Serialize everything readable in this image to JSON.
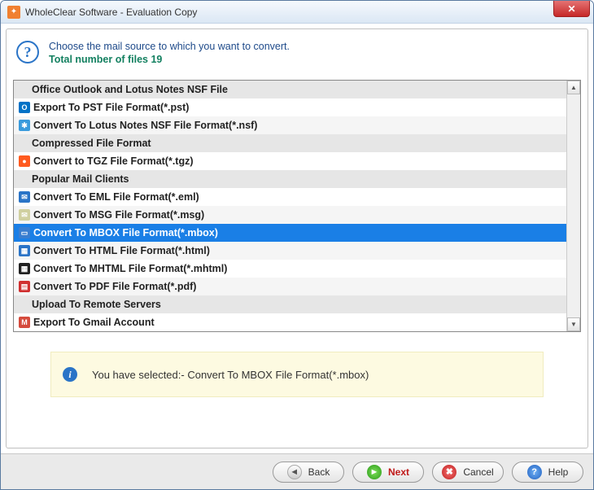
{
  "window": {
    "title": "WholeClear Software - Evaluation Copy"
  },
  "instruction": {
    "line1": "Choose the mail source to which you want to convert.",
    "line2": "Total number of files 19"
  },
  "list": [
    {
      "type": "header",
      "label": "Office Outlook and Lotus Notes NSF File"
    },
    {
      "type": "item",
      "icon": "outlook",
      "label": "Export To PST File Format(*.pst)"
    },
    {
      "type": "item",
      "icon": "lotus",
      "label": "Convert To Lotus Notes NSF File Format(*.nsf)"
    },
    {
      "type": "header",
      "label": "Compressed File Format"
    },
    {
      "type": "item",
      "icon": "tgz",
      "label": "Convert to TGZ File Format(*.tgz)"
    },
    {
      "type": "header",
      "label": "Popular Mail Clients"
    },
    {
      "type": "item",
      "icon": "eml",
      "label": "Convert To EML File Format(*.eml)"
    },
    {
      "type": "item",
      "icon": "msg",
      "label": "Convert To MSG File Format(*.msg)"
    },
    {
      "type": "item",
      "icon": "mbox",
      "label": "Convert To MBOX File Format(*.mbox)",
      "selected": true
    },
    {
      "type": "item",
      "icon": "html",
      "label": "Convert To HTML File Format(*.html)"
    },
    {
      "type": "item",
      "icon": "mhtml",
      "label": "Convert To MHTML File Format(*.mhtml)"
    },
    {
      "type": "item",
      "icon": "pdf",
      "label": "Convert To PDF File Format(*.pdf)"
    },
    {
      "type": "header",
      "label": "Upload To Remote Servers"
    },
    {
      "type": "item",
      "icon": "gmail",
      "label": "Export To Gmail Account"
    }
  ],
  "icons": {
    "outlook": {
      "bg": "#0072c6",
      "glyph": "O"
    },
    "lotus": {
      "bg": "#3a9bdc",
      "glyph": "✱"
    },
    "tgz": {
      "bg": "#ff5a1f",
      "glyph": "●"
    },
    "eml": {
      "bg": "#2a74c7",
      "glyph": "✉"
    },
    "msg": {
      "bg": "#d0d0a0",
      "glyph": "✉"
    },
    "mbox": {
      "bg": "#3a7ed0",
      "glyph": "▭"
    },
    "html": {
      "bg": "#2a74c7",
      "glyph": "▦"
    },
    "mhtml": {
      "bg": "#222222",
      "glyph": "▦"
    },
    "pdf": {
      "bg": "#d03030",
      "glyph": "▤"
    },
    "gmail": {
      "bg": "#d54b3d",
      "glyph": "M"
    }
  },
  "notice": {
    "prefix": "You have selected:- ",
    "value": "Convert To MBOX File Format(*.mbox)"
  },
  "buttons": {
    "back": "Back",
    "next": "Next",
    "cancel": "Cancel",
    "help": "Help"
  }
}
